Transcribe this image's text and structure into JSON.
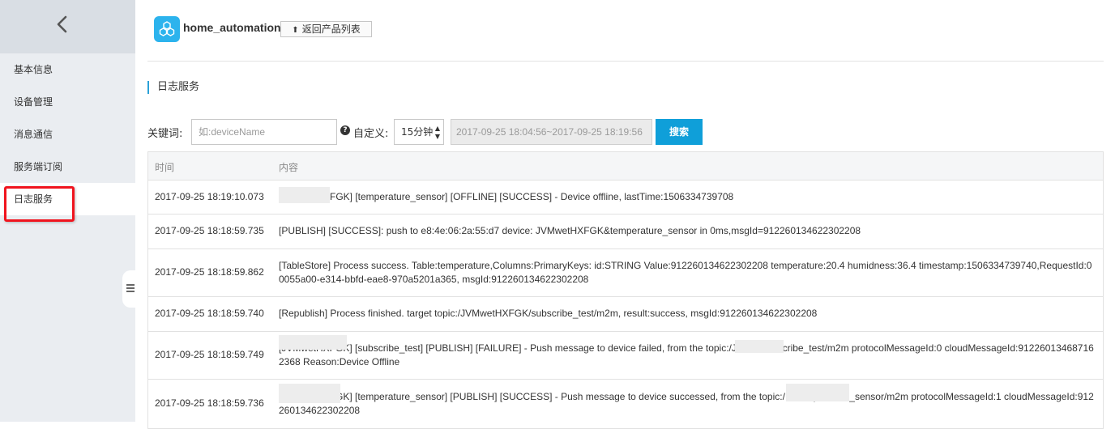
{
  "sidebar": {
    "items": [
      {
        "label": "基本信息"
      },
      {
        "label": "设备管理"
      },
      {
        "label": "消息通信"
      },
      {
        "label": "服务端订阅"
      },
      {
        "label": "日志服务"
      }
    ]
  },
  "header": {
    "product_name": "home_automation",
    "back_button_label": "返回产品列表"
  },
  "section_title": "日志服务",
  "filter": {
    "keyword_label": "关键词:",
    "keyword_placeholder": "如:deviceName",
    "custom_label": "自定义:",
    "range_value": "15分钟",
    "date_range": "2017-09-25 18:04:56~2017-09-25 18:19:56",
    "search_label": "搜索"
  },
  "table": {
    "columns": [
      "时间",
      "内容"
    ],
    "rows": [
      {
        "time": "2017-09-25 18:19:10.073",
        "content": "FGK] [temperature_sensor] [OFFLINE] [SUCCESS] - Device offline, lastTime:1506334739708"
      },
      {
        "time": "2017-09-25 18:18:59.735",
        "content": "[PUBLISH] [SUCCESS]: push to e8:4e:06:2a:55:d7 device: JVMwetHXFGK&temperature_sensor in 0ms,msgId=912260134622302208"
      },
      {
        "time": "2017-09-25 18:18:59.862",
        "content": "[TableStore] Process success. Table:temperature,Columns:PrimaryKeys: id:STRING Value:912260134622302208 temperature:20.4 humidness:36.4 timestamp:1506334739740,RequestId:00055a00-e314-bbfd-eae8-970a5201a365, msgId:912260134622302208"
      },
      {
        "time": "2017-09-25 18:18:59.740",
        "content": "[Republish] Process finished. target topic:/JVMwetHXFGK/subscribe_test/m2m, result:success, msgId:912260134622302208"
      },
      {
        "time": "2017-09-25 18:18:59.749",
        "content": "[JVMwetHXFGK] [subscribe_test] [PUBLISH] [FAILURE] - Push message to device failed, from the topic:/J            FGK/subscribe_test/m2m protocolMessageId:0 cloudMessageId:912260134687162368 Reason:Device Offline"
      },
      {
        "time": "2017-09-25 18:18:59.736",
        "content": "[JVMwetHXFGK] [temperature_sensor] [PUBLISH] [SUCCESS] - Push message to device successed, from the topic:/              K/temperature_sensor/m2m protocolMessageId:1 cloudMessageId:912260134622302208"
      }
    ]
  }
}
